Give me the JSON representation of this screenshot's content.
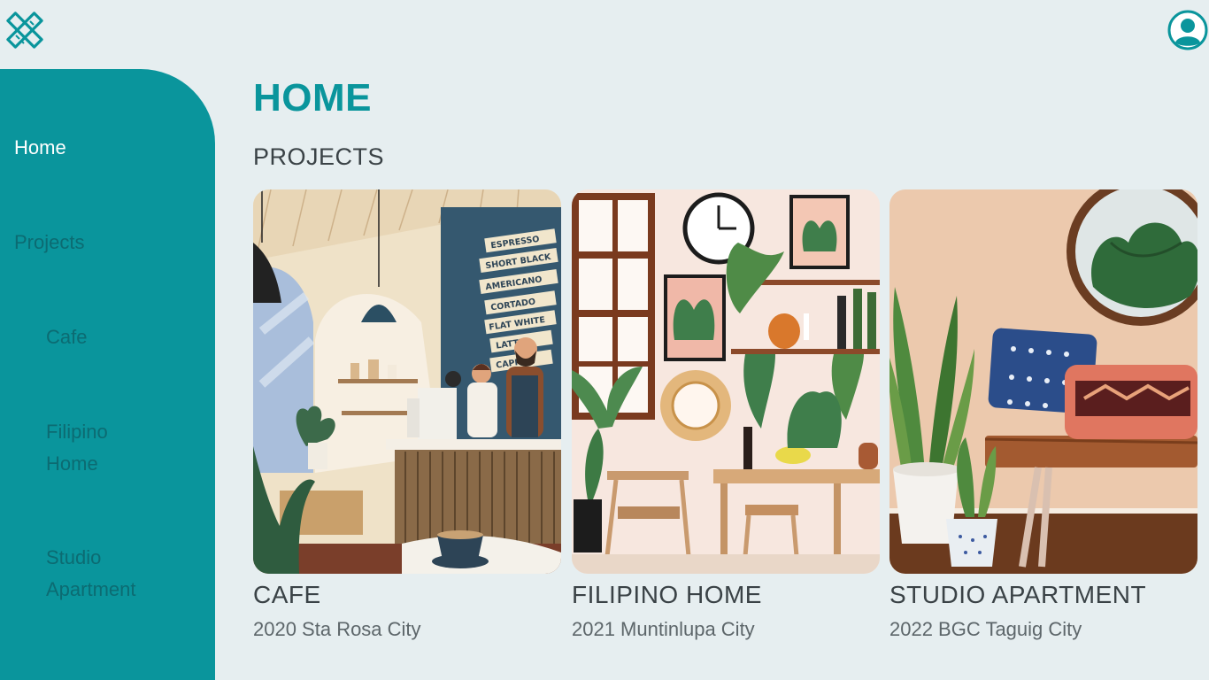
{
  "header": {
    "logo_icon": "ruler-pencil-icon",
    "user_icon": "user-avatar-icon",
    "accent": "#0a959c"
  },
  "sidebar": {
    "items": [
      {
        "label": "Home"
      },
      {
        "label": "Projects"
      },
      {
        "label": "Cafe"
      },
      {
        "label": "Filipino Home"
      },
      {
        "label": "Studio Apartment"
      }
    ]
  },
  "main": {
    "title": "HOME",
    "section": "PROJECTS",
    "projects": [
      {
        "title": "CAFE",
        "subtitle": "2020 Sta Rosa City"
      },
      {
        "title": "FILIPINO HOME",
        "subtitle": "2021 Muntinlupa City"
      },
      {
        "title": "STUDIO APARTMENT",
        "subtitle": "2022 BGC Taguig City"
      }
    ],
    "cafe_menu": [
      "ESPRESSO",
      "SHORT BLACK",
      "AMERICANO",
      "CORTADO",
      "FLAT WHITE",
      "LATTE",
      "CAPPU"
    ]
  }
}
